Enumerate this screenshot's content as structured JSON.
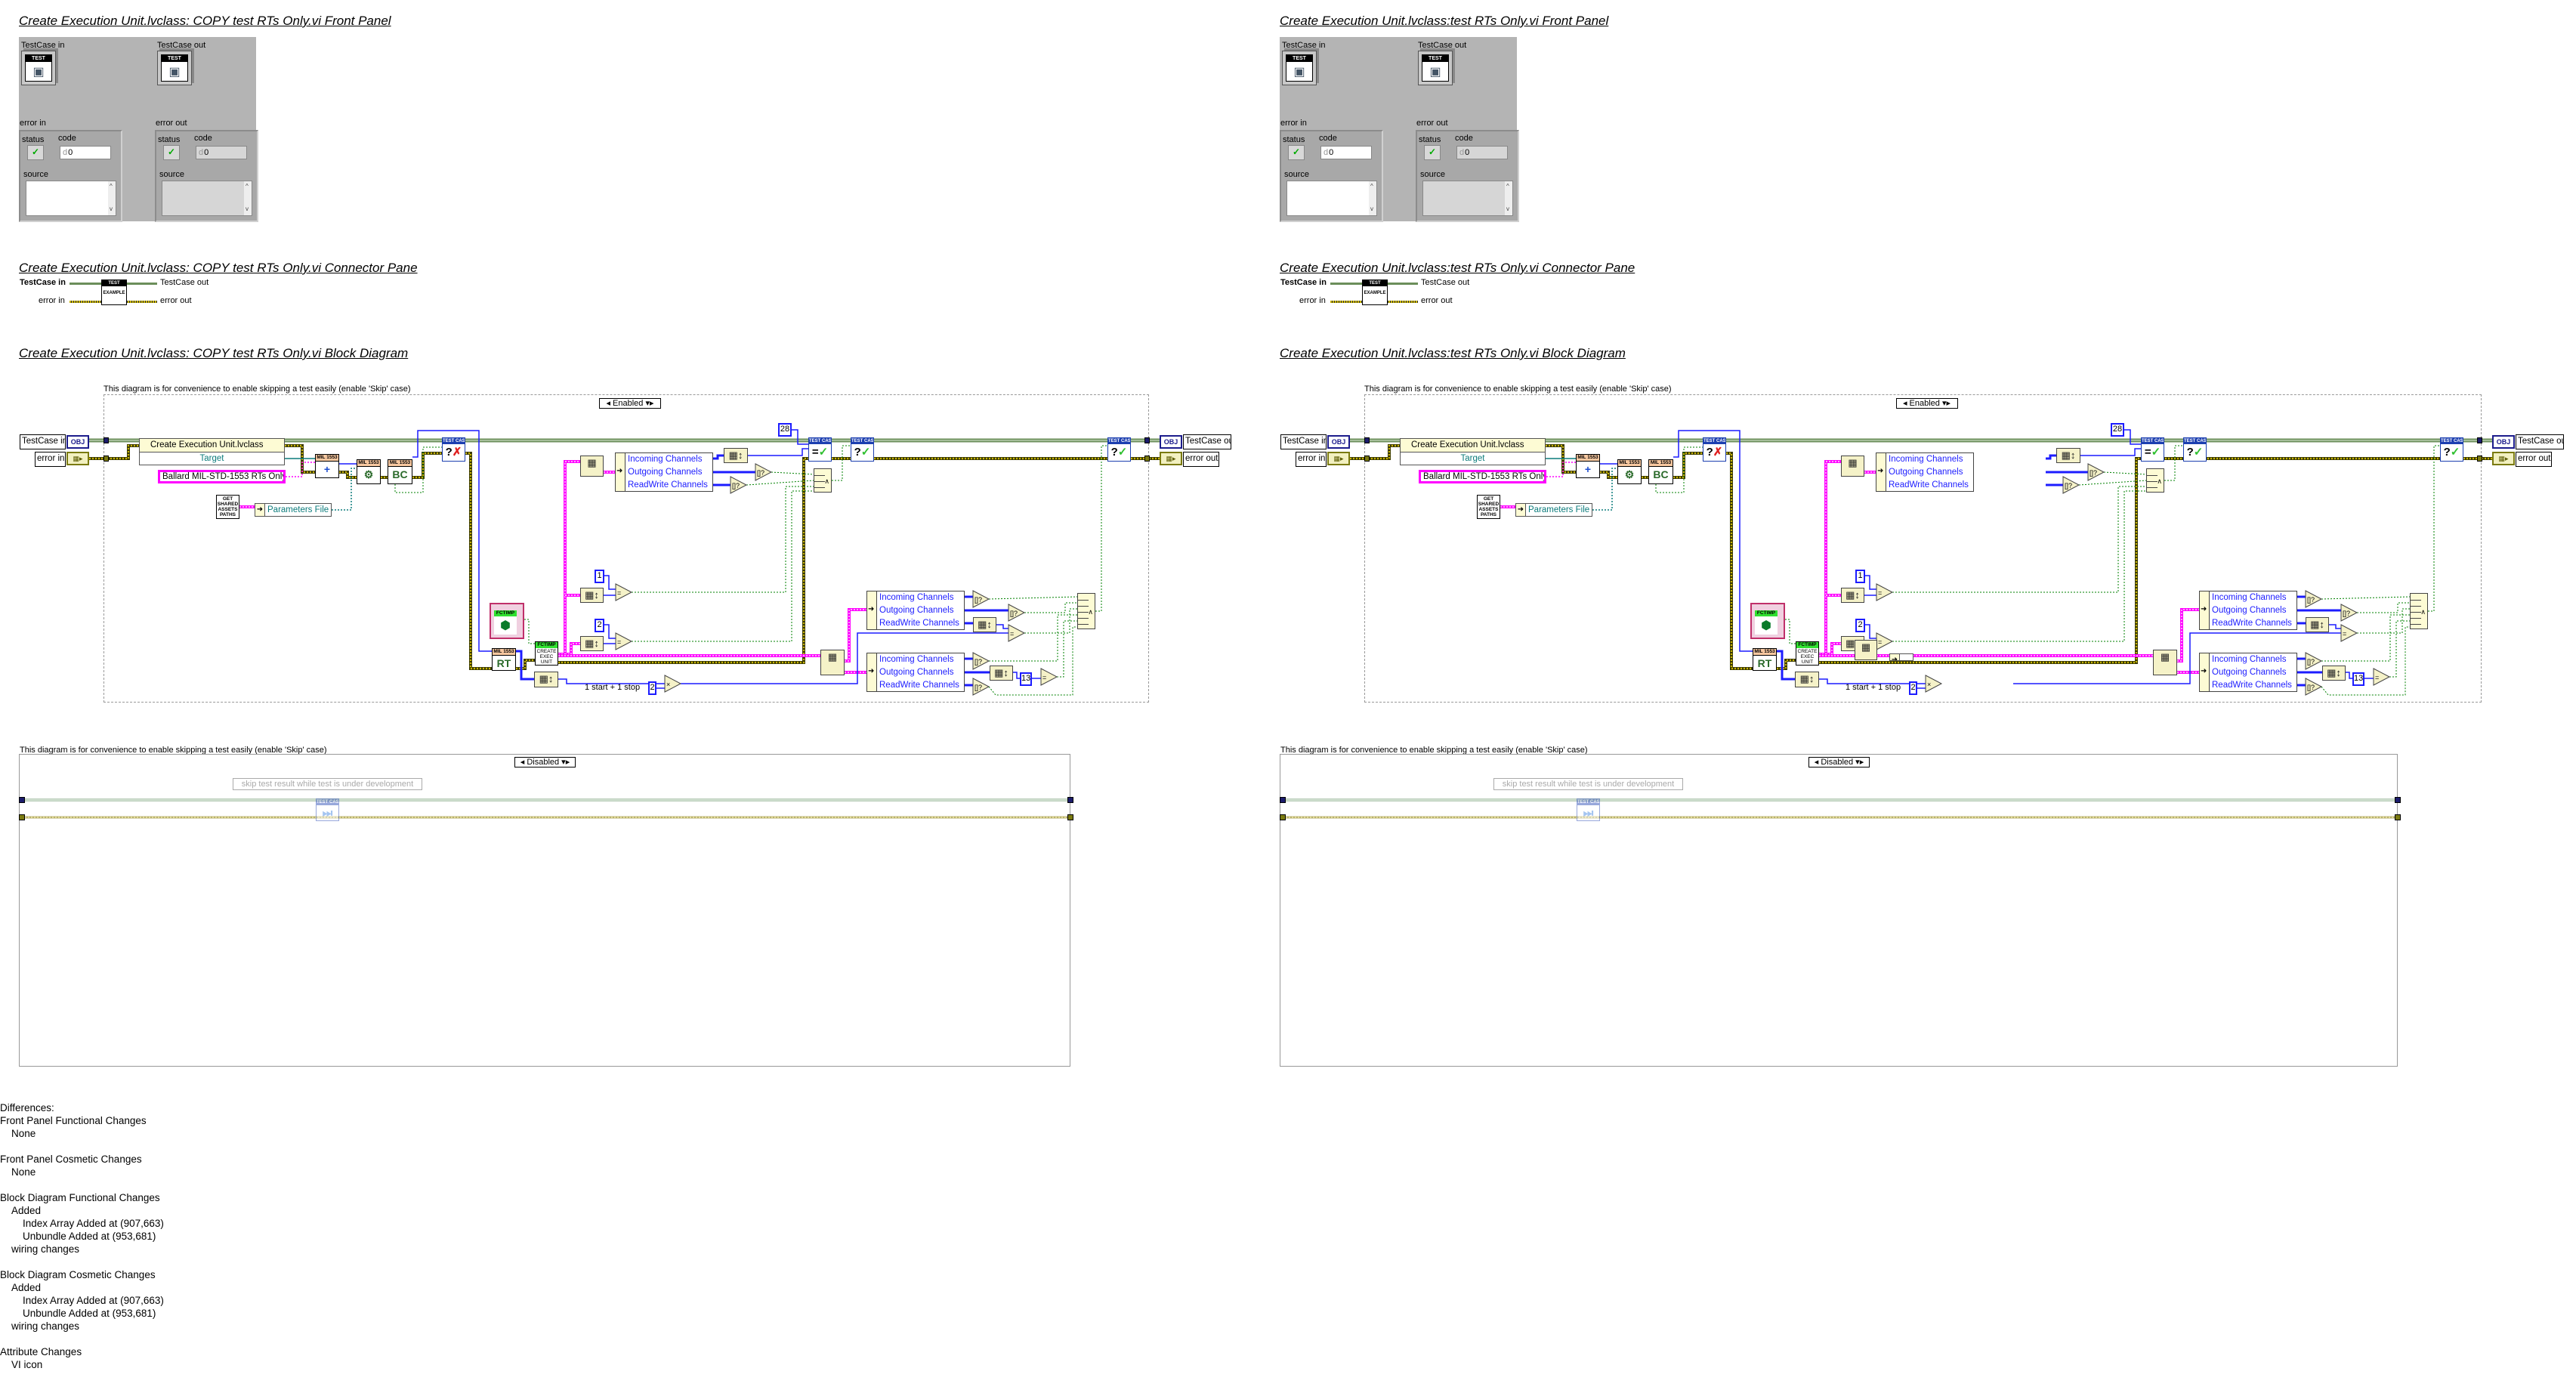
{
  "left": {
    "fp_title": "Create Execution Unit.lvclass:  COPY  test RTs Only.vi Front Panel",
    "cp_title": "Create Execution Unit.lvclass:  COPY  test RTs Only.vi Connector Pane",
    "bd_title": "Create Execution Unit.lvclass:  COPY  test RTs Only.vi Block Diagram"
  },
  "right": {
    "fp_title": "Create Execution Unit.lvclass:test RTs Only.vi Front Panel",
    "cp_title": "Create Execution Unit.lvclass:test RTs Only.vi Connector Pane",
    "bd_title": "Create Execution Unit.lvclass:test RTs Only.vi Block Diagram"
  },
  "front_panel": {
    "testcase_in": "TestCase in",
    "testcase_out": "TestCase out",
    "error_in": "error in",
    "error_out": "error out",
    "status": "status",
    "code": "code",
    "code_radix": "d",
    "code_value": "0",
    "source": "source",
    "icon_header": "TEST"
  },
  "connector": {
    "testcase_in": "TestCase in",
    "testcase_out": "TestCase out",
    "error_in": "error in",
    "error_out": "error out",
    "icon_header": "TEST",
    "icon_footer": "EXAMPLE"
  },
  "diagram": {
    "comment": "This diagram is for convenience to enable skipping a test easily (enable 'Skip' case)",
    "enabled": "◂ Enabled ▾▸",
    "disabled": "◂ Disabled ▾▸",
    "skip_note": "skip test result while test is under development",
    "testcase_in": "TestCase in",
    "error_in": "error in",
    "testcase_out": "TestCase out",
    "error_out": "error out",
    "obj": "OBJ",
    "create_node": "Create Execution Unit.lvclass",
    "target": "Target",
    "ballard": "Ballard MIL-STD-1553 RTs Only",
    "mil": "MIL 1553",
    "bc": "BC",
    "rt": "RT",
    "get_shared": "GET SHARED ASSETS PATHS",
    "params": "Parameters File",
    "tc_header": "TEST CASE",
    "incoming": "Incoming Channels",
    "outgoing": "Outgoing Channels",
    "readwrite": "ReadWrite Channels",
    "const_28": "28",
    "const_1": "1",
    "const_2": "2",
    "const_13": "13",
    "start_stop": "1 start + 1 stop",
    "fctimp": "FCTIMP",
    "create_exec": "CREATE EXEC UNIT"
  },
  "icons": {
    "error_cluster": "▦▸",
    "plus": "+",
    "config": "⚙",
    "search": "🔍",
    "question": "?",
    "fail": "✗",
    "check": "✓",
    "equal": "=",
    "index_array": "▦",
    "array_size": "▦↕",
    "not_empty": "[]?",
    "multiply": "×",
    "and": "∧",
    "arrow": "➜",
    "cube": "⬢",
    "skip": "⏭",
    "status_check": "✓",
    "scroll_up": "^",
    "scroll_down": "v",
    "testcase_icon": "▣"
  },
  "colors": {
    "class_wire": "#6b8e5a",
    "error_wire": "#c8b400",
    "numeric_wire": "#1c1cff",
    "string_wire": "#ff00ff",
    "path_wire": "#0b7b7b",
    "boolean_wire": "#008000",
    "panel_bg": "#b4b4b4"
  },
  "differences": {
    "heading": "Differences:",
    "sections": [
      {
        "title": "Front Panel Functional Changes",
        "items": [
          {
            "text": "None",
            "children": []
          }
        ]
      },
      {
        "title": "Front Panel Cosmetic Changes",
        "items": [
          {
            "text": "None",
            "children": []
          }
        ]
      },
      {
        "title": "Block Diagram Functional Changes",
        "items": [
          {
            "text": "Added",
            "children": [
              "Index Array  Added at (907,663)",
              "Unbundle  Added at (953,681)"
            ]
          },
          {
            "text": "wiring changes",
            "children": []
          }
        ]
      },
      {
        "title": "Block Diagram Cosmetic Changes",
        "items": [
          {
            "text": "Added",
            "children": [
              "Index Array  Added at (907,663)",
              "Unbundle  Added at (953,681)"
            ]
          },
          {
            "text": "wiring changes",
            "children": []
          }
        ]
      },
      {
        "title": "Attribute Changes",
        "items": [
          {
            "text": "VI icon",
            "children": []
          }
        ]
      }
    ]
  }
}
